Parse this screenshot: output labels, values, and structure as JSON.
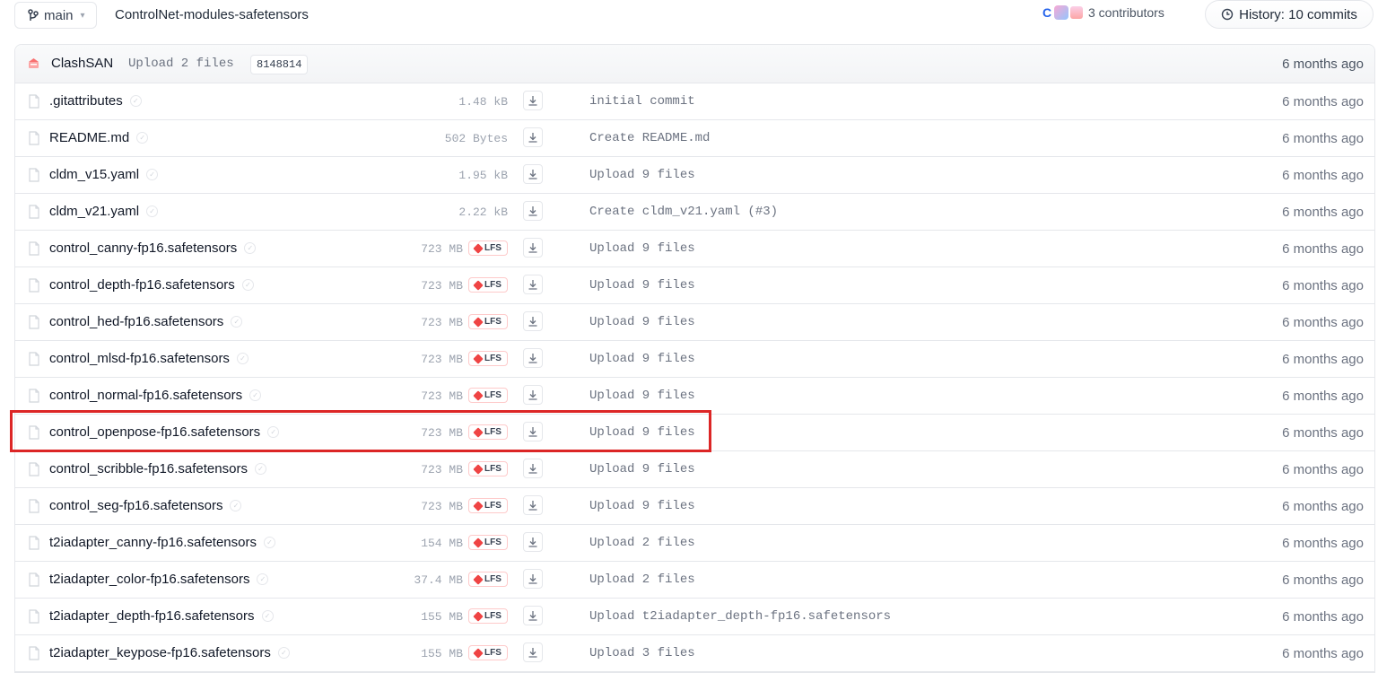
{
  "header": {
    "branch": "main",
    "repo_path": "ControlNet-modules-safetensors",
    "contributors_label": "3 contributors",
    "contributor_initial": "C",
    "history_label": "History: 10 commits"
  },
  "last_commit": {
    "author": "ClashSAN",
    "message": "Upload 2 files",
    "hash": "8148814",
    "time": "6 months ago"
  },
  "lfs_label": "LFS",
  "files": [
    {
      "name": ".gitattributes",
      "size": "1.48 kB",
      "lfs": false,
      "commit": "initial commit",
      "time": "6 months ago"
    },
    {
      "name": "README.md",
      "size": "502 Bytes",
      "lfs": false,
      "commit": "Create README.md",
      "time": "6 months ago"
    },
    {
      "name": "cldm_v15.yaml",
      "size": "1.95 kB",
      "lfs": false,
      "commit": "Upload 9 files",
      "time": "6 months ago"
    },
    {
      "name": "cldm_v21.yaml",
      "size": "2.22 kB",
      "lfs": false,
      "commit": "Create cldm_v21.yaml (#3)",
      "time": "6 months ago"
    },
    {
      "name": "control_canny-fp16.safetensors",
      "size": "723 MB",
      "lfs": true,
      "commit": "Upload 9 files",
      "time": "6 months ago"
    },
    {
      "name": "control_depth-fp16.safetensors",
      "size": "723 MB",
      "lfs": true,
      "commit": "Upload 9 files",
      "time": "6 months ago"
    },
    {
      "name": "control_hed-fp16.safetensors",
      "size": "723 MB",
      "lfs": true,
      "commit": "Upload 9 files",
      "time": "6 months ago"
    },
    {
      "name": "control_mlsd-fp16.safetensors",
      "size": "723 MB",
      "lfs": true,
      "commit": "Upload 9 files",
      "time": "6 months ago"
    },
    {
      "name": "control_normal-fp16.safetensors",
      "size": "723 MB",
      "lfs": true,
      "commit": "Upload 9 files",
      "time": "6 months ago"
    },
    {
      "name": "control_openpose-fp16.safetensors",
      "size": "723 MB",
      "lfs": true,
      "commit": "Upload 9 files",
      "time": "6 months ago"
    },
    {
      "name": "control_scribble-fp16.safetensors",
      "size": "723 MB",
      "lfs": true,
      "commit": "Upload 9 files",
      "time": "6 months ago"
    },
    {
      "name": "control_seg-fp16.safetensors",
      "size": "723 MB",
      "lfs": true,
      "commit": "Upload 9 files",
      "time": "6 months ago"
    },
    {
      "name": "t2iadapter_canny-fp16.safetensors",
      "size": "154 MB",
      "lfs": true,
      "commit": "Upload 2 files",
      "time": "6 months ago"
    },
    {
      "name": "t2iadapter_color-fp16.safetensors",
      "size": "37.4 MB",
      "lfs": true,
      "commit": "Upload 2 files",
      "time": "6 months ago"
    },
    {
      "name": "t2iadapter_depth-fp16.safetensors",
      "size": "155 MB",
      "lfs": true,
      "commit": "Upload t2iadapter_depth-fp16.safetensors",
      "time": "6 months ago"
    },
    {
      "name": "t2iadapter_keypose-fp16.safetensors",
      "size": "155 MB",
      "lfs": true,
      "commit": "Upload 3 files",
      "time": "6 months ago"
    }
  ],
  "highlight_color": "#dc2626"
}
